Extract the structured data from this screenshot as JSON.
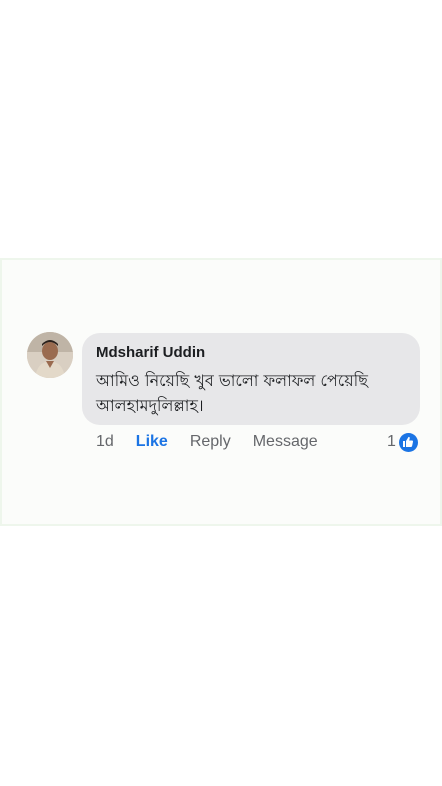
{
  "comment": {
    "author": "Mdsharif Uddin",
    "text": "আমিও নিয়েছি খুব ভালো ফলাফল পেয়েছি আলহামদুলিল্লাহ।",
    "timestamp": "1d",
    "reaction_count": "1"
  },
  "actions": {
    "like_label": "Like",
    "reply_label": "Reply",
    "message_label": "Message"
  },
  "colors": {
    "bubble": "#e7e7e9",
    "like_blue": "#1b74e4",
    "meta_gray": "#65676b"
  },
  "icons": {
    "reaction": "thumbs-up-icon"
  }
}
